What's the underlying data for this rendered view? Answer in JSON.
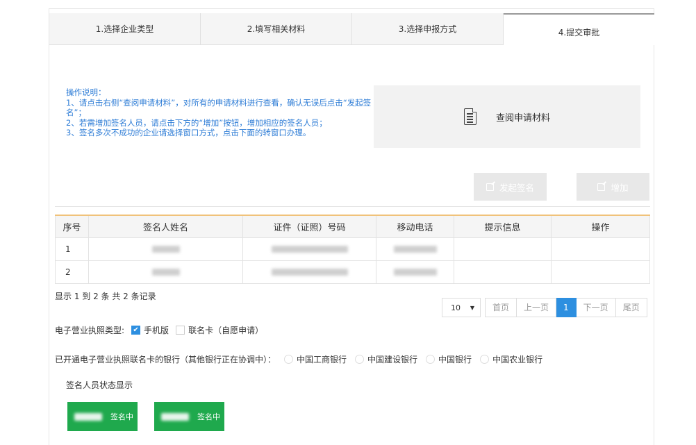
{
  "tabs": [
    {
      "label": "1.选择企业类型"
    },
    {
      "label": "2.填写相关材料"
    },
    {
      "label": "3.选择申报方式"
    },
    {
      "label": "4.提交审批"
    }
  ],
  "instructions": {
    "title": "操作说明：",
    "line1": "1、请点击右侧“查阅申请材料”，对所有的申请材料进行查看，确认无误后点击“发起签名”；",
    "line2": "2、若需增加签名人员，请点击下方的“增加”按钮，增加相应的签名人员；",
    "line3": "3、签名多次不成功的企业请选择窗口方式，点击下面的转窗口办理。"
  },
  "view_materials": {
    "label": "查阅申请材料",
    "icon": "document-icon"
  },
  "actions": {
    "start_sign": "发起签名",
    "add": "增加",
    "icon": "edit-icon"
  },
  "table": {
    "headers": [
      "序号",
      "签名人姓名",
      "证件（证照）号码",
      "移动电话",
      "提示信息",
      "操作"
    ],
    "rows": [
      {
        "no": "1",
        "hint": "",
        "op": ""
      },
      {
        "no": "2",
        "hint": "",
        "op": ""
      }
    ]
  },
  "records": "显示 1 到 2 条 共 2 条记录",
  "pagination": {
    "page_size": "10",
    "first": "首页",
    "prev": "上一页",
    "current": "1",
    "next": "下一页",
    "last": "尾页"
  },
  "license": {
    "label": "电子营业执照类型:",
    "option1": "手机版",
    "option1_checked": true,
    "option2": "联名卡（自愿申请）",
    "option2_checked": false
  },
  "banks": {
    "label": "已开通电子营业执照联名卡的银行（其他银行正在协调中）：",
    "options": [
      "中国工商银行",
      "中国建设银行",
      "中国银行",
      "中国农业银行"
    ]
  },
  "status": {
    "title": "签名人员状态显示",
    "cards": [
      {
        "status": "签名中"
      },
      {
        "status": "签名中"
      }
    ]
  },
  "colors": {
    "accent_blue": "#2d8fe0",
    "instruction_text": "#2d7cd6",
    "status_green": "#1fa94d",
    "table_top_border": "#f0c27a"
  }
}
